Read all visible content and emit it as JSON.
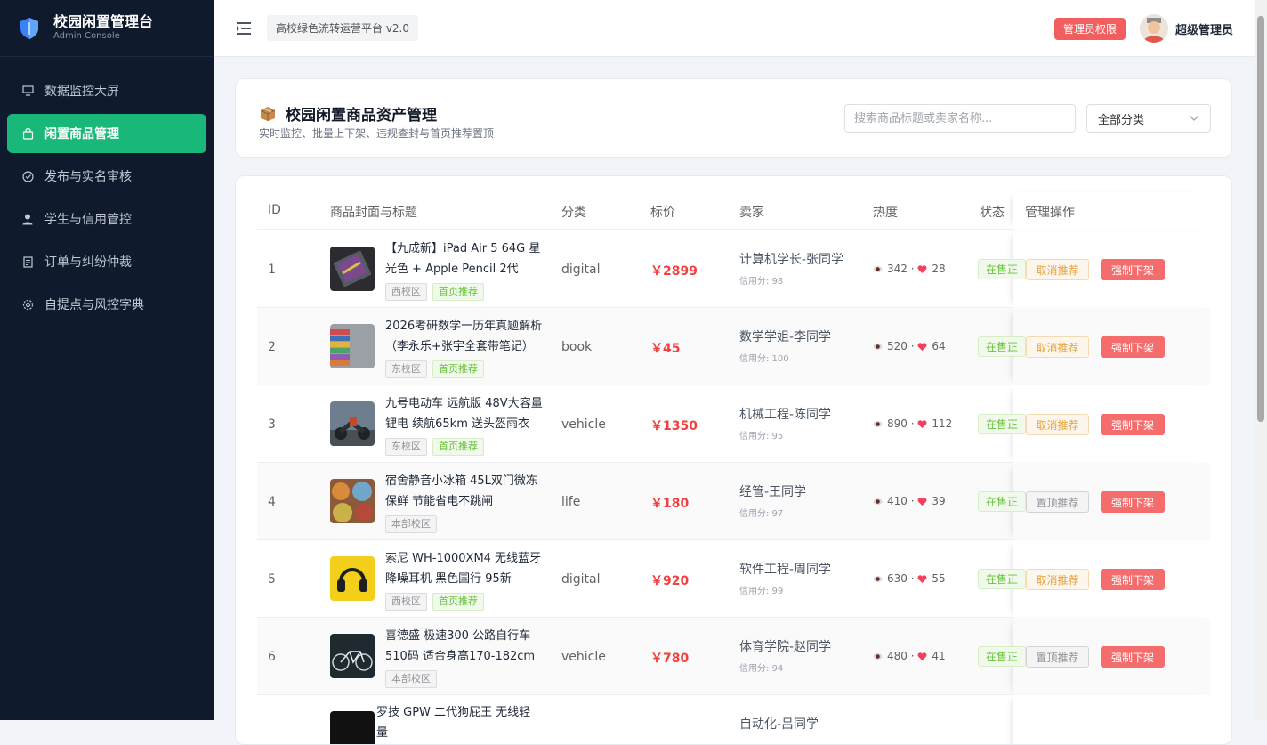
{
  "brand": {
    "title": "校园闲置管理台",
    "subtitle": "Admin Console"
  },
  "sidebar": {
    "items": [
      {
        "label": "数据监控大屏",
        "icon": "monitor-icon",
        "active": false
      },
      {
        "label": "闲置商品管理",
        "icon": "shopping-bag-icon",
        "active": true
      },
      {
        "label": "发布与实名审核",
        "icon": "check-circle-icon",
        "active": false
      },
      {
        "label": "学生与信用管控",
        "icon": "user-icon",
        "active": false
      },
      {
        "label": "订单与纠纷仲裁",
        "icon": "document-icon",
        "active": false
      },
      {
        "label": "自提点与风控字典",
        "icon": "gear-icon",
        "active": false
      }
    ]
  },
  "topbar": {
    "platform": "高校绿色流转运营平台 v2.0",
    "admin_badge": "管理员权限",
    "admin_name": "超级管理员"
  },
  "header": {
    "title": "校园闲置商品资产管理",
    "subtitle": "实时监控、批量上下架、违规查封与首页推荐置顶",
    "search_placeholder": "搜索商品标题或卖家名称...",
    "category_select": "全部分类"
  },
  "table": {
    "columns": [
      "ID",
      "商品封面与标题",
      "分类",
      "标价",
      "卖家",
      "热度",
      "状态",
      "管理操作"
    ],
    "rows": [
      {
        "id": "1",
        "title": "【九成新】iPad Air 5 64G 星光色 + Apple Pencil 2代",
        "campus": "西校区",
        "recommended": "首页推荐",
        "category": "digital",
        "price": "￥2899",
        "seller": "计算机学长-张同学",
        "credit": "信用分: 98",
        "views": "342 ·",
        "likes": "28",
        "status": "在售正",
        "op1": "取消推荐",
        "op2": "强制下架"
      },
      {
        "id": "2",
        "title": "2026考研数学一历年真题解析（李永乐+张宇全套带笔记）",
        "campus": "东校区",
        "recommended": "首页推荐",
        "category": "book",
        "price": "￥45",
        "seller": "数学学姐-李同学",
        "credit": "信用分: 100",
        "views": "520 ·",
        "likes": "64",
        "status": "在售正",
        "op1": "取消推荐",
        "op2": "强制下架"
      },
      {
        "id": "3",
        "title": "九号电动车 远航版 48V大容量锂电 续航65km 送头盔雨衣",
        "campus": "东校区",
        "recommended": "首页推荐",
        "category": "vehicle",
        "price": "￥1350",
        "seller": "机械工程-陈同学",
        "credit": "信用分: 95",
        "views": "890 ·",
        "likes": "112",
        "status": "在售正",
        "op1": "取消推荐",
        "op2": "强制下架"
      },
      {
        "id": "4",
        "title": "宿舍静音小冰箱 45L双门微冻保鲜 节能省电不跳闸",
        "campus": "本部校区",
        "recommended": "",
        "category": "life",
        "price": "￥180",
        "seller": "经管-王同学",
        "credit": "信用分: 97",
        "views": "410 ·",
        "likes": "39",
        "status": "在售正",
        "op1": "置顶推荐",
        "op2": "强制下架"
      },
      {
        "id": "5",
        "title": "索尼 WH-1000XM4 无线蓝牙降噪耳机 黑色国行 95新",
        "campus": "西校区",
        "recommended": "首页推荐",
        "category": "digital",
        "price": "￥920",
        "seller": "软件工程-周同学",
        "credit": "信用分: 99",
        "views": "630 ·",
        "likes": "55",
        "status": "在售正",
        "op1": "取消推荐",
        "op2": "强制下架"
      },
      {
        "id": "6",
        "title": "喜德盛 极速300 公路自行车 510码 适合身高170-182cm",
        "campus": "本部校区",
        "recommended": "",
        "category": "vehicle",
        "price": "￥780",
        "seller": "体育学院-赵同学",
        "credit": "信用分: 94",
        "views": "480 ·",
        "likes": "41",
        "status": "在售正",
        "op1": "置顶推荐",
        "op2": "强制下架"
      },
      {
        "id": "",
        "title": "罗技 GPW 二代狗屁王 无线轻量",
        "campus": "",
        "recommended": "",
        "category": "",
        "price": "",
        "seller": "自动化-吕同学",
        "credit": "",
        "views": "",
        "likes": "",
        "status": "",
        "op1": "",
        "op2": ""
      }
    ]
  },
  "colors": {
    "sidebar_bg": "#0f1b2d",
    "active": "#19b87a",
    "price": "#f53f3f",
    "danger": "#f56c6c"
  }
}
